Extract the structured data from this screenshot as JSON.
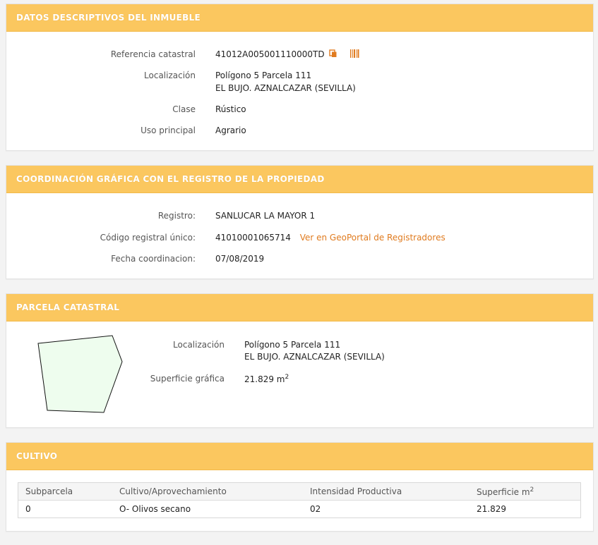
{
  "datos": {
    "title": "DATOS DESCRIPTIVOS DEL INMUEBLE",
    "ref_label": "Referencia catastral",
    "ref_value": "41012A005001110000TD",
    "loc_label": "Localización",
    "loc_line1": "Polígono 5 Parcela 111",
    "loc_line2": "EL BUJO. AZNALCAZAR (SEVILLA)",
    "clase_label": "Clase",
    "clase_value": "Rústico",
    "uso_label": "Uso principal",
    "uso_value": "Agrario",
    "icons": [
      "copy-icon",
      "barcode-icon"
    ]
  },
  "coordinacion": {
    "title": "COORDINACIÓN GRÁFICA CON EL REGISTRO DE LA PROPIEDAD",
    "registro_label": "Registro:",
    "registro_value": "SANLUCAR LA MAYOR 1",
    "codigo_label": "Código registral único:",
    "codigo_value": "41010001065714",
    "geoportal_link": "Ver en GeoPortal de Registradores",
    "fecha_label": "Fecha coordinacion:",
    "fecha_value": "07/08/2019"
  },
  "parcela": {
    "title": "PARCELA CATASTRAL",
    "loc_label": "Localización",
    "loc_line1": "Polígono 5 Parcela 111",
    "loc_line2": "EL BUJO. AZNALCAZAR (SEVILLA)",
    "sup_label": "Superficie gráfica",
    "sup_value": "21.829 m",
    "sup_unit_exp": "2",
    "shape_fill": "#eefdee"
  },
  "cultivo": {
    "title": "CULTIVO",
    "headers": [
      "Subparcela",
      "Cultivo/Aprovechamiento",
      "Intensidad Productiva",
      "Superficie m"
    ],
    "header_exp": "2",
    "rows": [
      [
        "0",
        "O- Olivos secano",
        "02",
        "21.829"
      ]
    ]
  },
  "colors": {
    "header_bg": "#fbc75f",
    "link": "#e07b1f"
  }
}
